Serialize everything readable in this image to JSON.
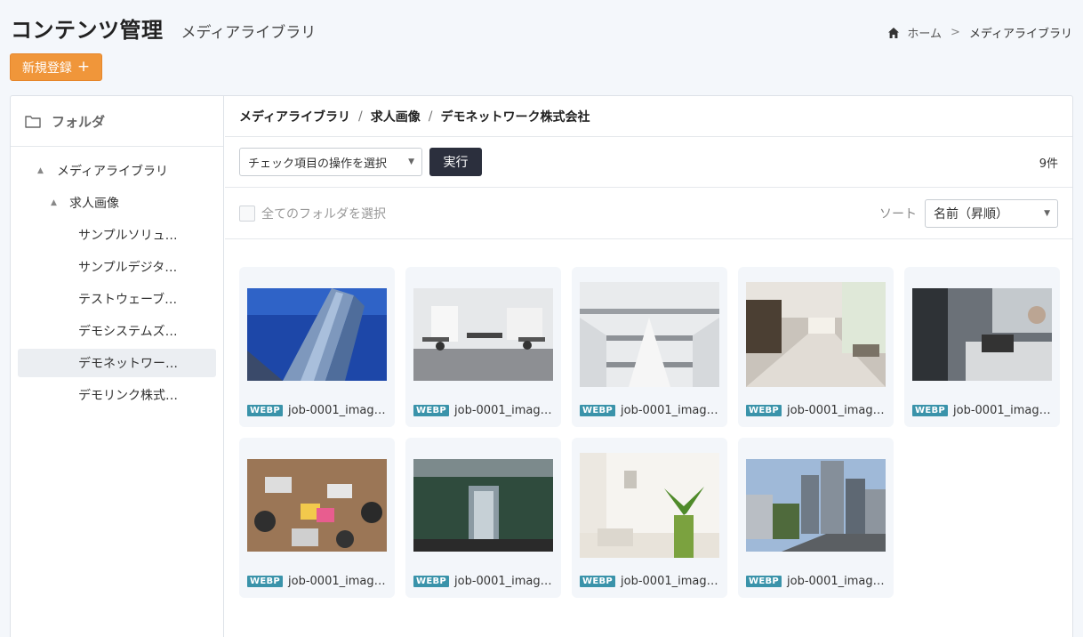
{
  "header": {
    "title": "コンテンツ管理",
    "subtitle": "メディアライブラリ",
    "new_button_label": "新規登録",
    "new_button_icon": "plus-icon"
  },
  "breadcrumb": {
    "home_icon": "home-icon",
    "home": "ホーム",
    "separator": ">",
    "current": "メディアライブラリ"
  },
  "sidebar": {
    "title": "フォルダ",
    "title_icon": "folder-icon",
    "root": "メディアライブラリ",
    "child": "求人画像",
    "items": [
      "サンプルソリュ…",
      "サンプルデジタ…",
      "テストウェーブ…",
      "デモシステムズ…",
      "デモネットワー…",
      "デモリンク株式…"
    ],
    "selected_index": 4
  },
  "main": {
    "path": [
      "メディアライブラリ",
      "求人画像",
      "デモネットワーク株式会社"
    ],
    "path_separator": "/",
    "bulk_select_value": "チェック項目の操作を選択",
    "exec_label": "実行",
    "count": "9件",
    "select_all_label": "全てのフォルダを選択",
    "sort_label": "ソート",
    "sort_value": "名前（昇順）"
  },
  "files": [
    {
      "badge": "WEBP",
      "name": "job-0001_imag…",
      "thumb": "building-low-angle"
    },
    {
      "badge": "WEBP",
      "name": "job-0001_imag…",
      "thumb": "white-office"
    },
    {
      "badge": "WEBP",
      "name": "job-0001_imag…",
      "thumb": "library-interior"
    },
    {
      "badge": "WEBP",
      "name": "job-0001_imag…",
      "thumb": "lobby-corridor"
    },
    {
      "badge": "WEBP",
      "name": "job-0001_imag…",
      "thumb": "business-meeting"
    },
    {
      "badge": "WEBP",
      "name": "job-0001_imag…",
      "thumb": "team-desk-overhead"
    },
    {
      "badge": "WEBP",
      "name": "job-0001_imag…",
      "thumb": "revolving-door-entrance"
    },
    {
      "badge": "WEBP",
      "name": "job-0001_imag…",
      "thumb": "bright-room-plant"
    },
    {
      "badge": "WEBP",
      "name": "job-0001_imag…",
      "thumb": "city-street-towers"
    }
  ],
  "colors": {
    "accent": "#f0963a",
    "dark_button": "#2b2f3d",
    "badge": "#3a93aa",
    "background": "#f4f7fb"
  }
}
